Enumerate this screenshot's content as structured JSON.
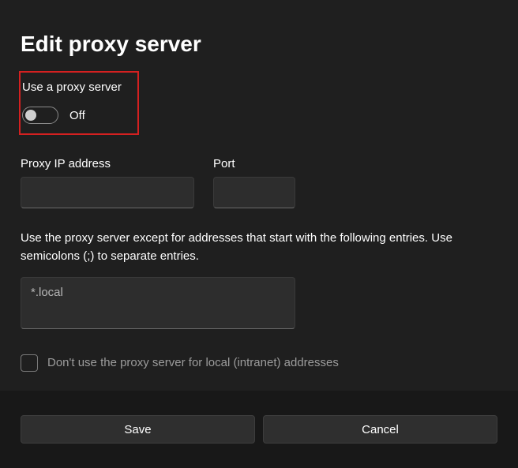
{
  "title": "Edit proxy server",
  "toggle": {
    "label": "Use a proxy server",
    "state": "Off"
  },
  "fields": {
    "ip": {
      "label": "Proxy IP address",
      "value": ""
    },
    "port": {
      "label": "Port",
      "value": ""
    }
  },
  "exceptions": {
    "description": "Use the proxy server except for addresses that start with the following entries. Use semicolons (;) to separate entries.",
    "value": "*.local"
  },
  "checkbox": {
    "label": "Don't use the proxy server for local (intranet) addresses"
  },
  "buttons": {
    "save": "Save",
    "cancel": "Cancel"
  }
}
